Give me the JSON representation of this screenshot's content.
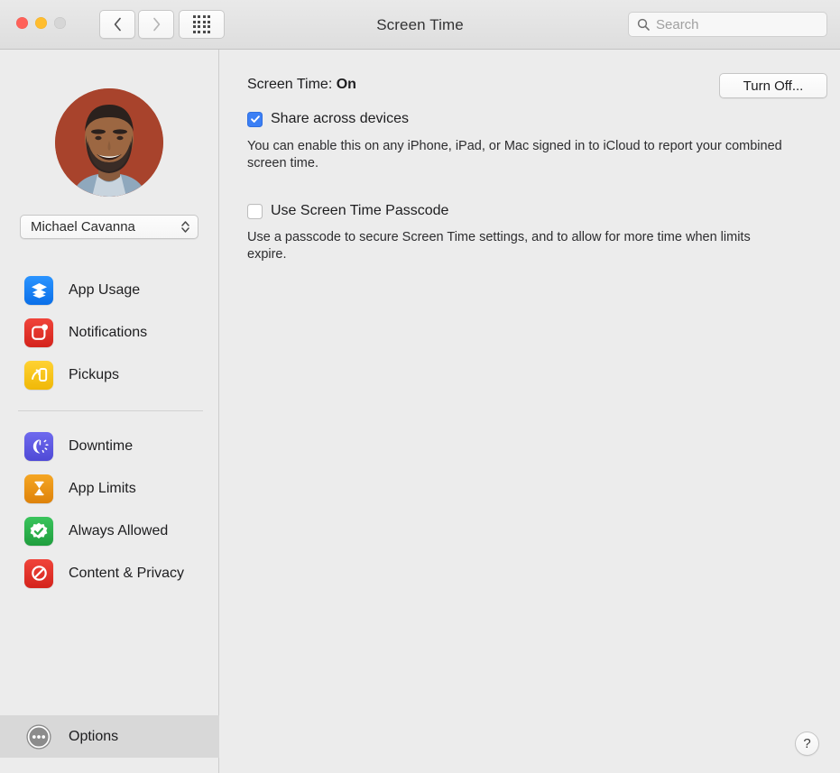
{
  "window": {
    "title": "Screen Time"
  },
  "titlebar": {
    "traffic_lights": [
      {
        "name": "close",
        "color": "#ff6159"
      },
      {
        "name": "minimize",
        "color": "#ffbd2e"
      },
      {
        "name": "zoom",
        "color": "#d6d6d6"
      }
    ],
    "back_label": "Back",
    "forward_label": "Forward",
    "grid_label": "Show All Preferences",
    "search": {
      "placeholder": "Search",
      "value": "",
      "icon": "search-icon"
    }
  },
  "sidebar": {
    "avatar": {
      "icon": "user-avatar-photo",
      "alt": "Michael Cavanna"
    },
    "user_popup": {
      "value": "Michael Cavanna",
      "icon": "chevron-up-down-icon"
    },
    "group_one": [
      {
        "label": "App Usage",
        "icon": "app-usage-icon",
        "color": "#0a84ff"
      },
      {
        "label": "Notifications",
        "icon": "notifications-icon",
        "color": "#e02a22"
      },
      {
        "label": "Pickups",
        "icon": "pickups-icon",
        "color": "#f5c016"
      }
    ],
    "group_two": [
      {
        "label": "Downtime",
        "icon": "downtime-icon",
        "color": "#5a55e0"
      },
      {
        "label": "App Limits",
        "icon": "app-limits-icon",
        "color": "#e8920c"
      },
      {
        "label": "Always Allowed",
        "icon": "always-allowed-icon",
        "color": "#2aae4a"
      },
      {
        "label": "Content & Privacy",
        "icon": "content-privacy-icon",
        "color": "#e02a22"
      }
    ],
    "options": {
      "label": "Options",
      "icon": "options-ellipsis-icon",
      "selected": true
    }
  },
  "main": {
    "status_label": "Screen Time:",
    "status_value": "On",
    "turn_off_label": "Turn Off...",
    "share": {
      "label": "Share across devices",
      "checked": true,
      "help": "You can enable this on any iPhone, iPad, or Mac signed in to iCloud to report your combined screen time."
    },
    "passcode": {
      "label": "Use Screen Time Passcode",
      "checked": false,
      "help": "Use a passcode to secure Screen Time settings, and to allow for more time when limits expire."
    },
    "help_button": {
      "label": "?",
      "icon": "question-mark-icon"
    }
  },
  "colors": {
    "accent": "#3b7ff5",
    "window_bg": "#ececec",
    "selection": "#d8d8d8"
  }
}
